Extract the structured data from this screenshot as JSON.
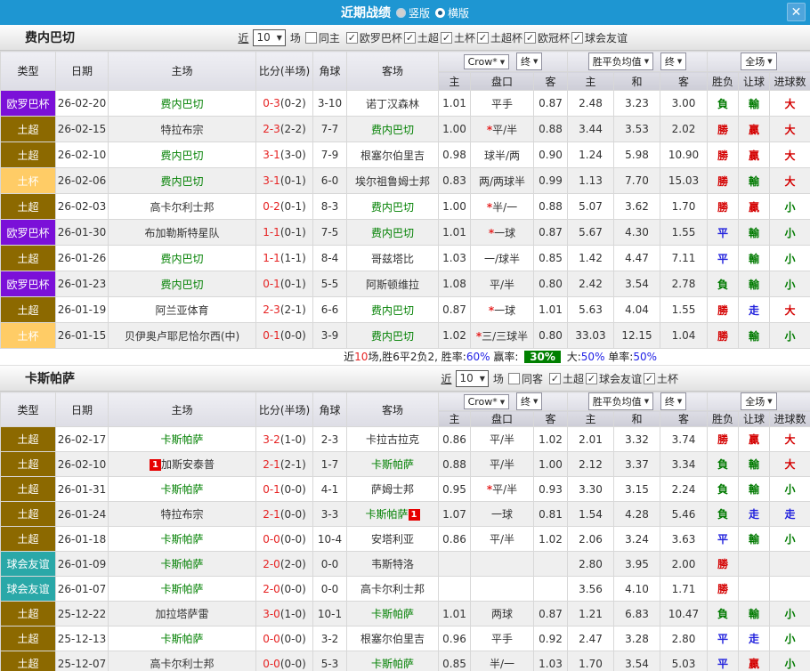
{
  "titlebar": {
    "title": "近期战绩",
    "radio_vertical": "竖版",
    "radio_horizontal": "横版",
    "selected_layout": "横版",
    "close_label": "✕"
  },
  "table_header": {
    "cols": [
      "类型",
      "日期",
      "主场",
      "比分(半场)",
      "角球",
      "客场"
    ],
    "group1": "Crow*",
    "group1b": "终",
    "group2": "胜平负均值",
    "group2b": "终",
    "group3": "全场",
    "sub": [
      "主",
      "盘口",
      "客",
      "主",
      "和",
      "客",
      "胜负",
      "让球",
      "进球数"
    ]
  },
  "colors": {
    "titlebar": "#1E96D2",
    "comp": {
      "欧罗巴杯": "#7B10D8",
      "土超": "#8C6900",
      "土杯": "#FFCC66",
      "球会友谊": "#2AA8A8"
    },
    "result": {
      "勝": "red",
      "負": "green",
      "平": "blue",
      "贏": "red",
      "輸": "green",
      "走": "blue",
      "大": "red",
      "小": "green"
    },
    "focus_team": "#008000",
    "score": "#E62222",
    "win_rate_badge": "#008000"
  },
  "sections": [
    {
      "team": "费内巴切",
      "filter": {
        "near": "近",
        "count": "10",
        "games": "场",
        "same_label": "同主",
        "same_checked": false,
        "leagues": [
          {
            "label": "欧罗巴杯",
            "checked": true
          },
          {
            "label": "土超",
            "checked": true
          },
          {
            "label": "土杯",
            "checked": true
          },
          {
            "label": "土超杯",
            "checked": true
          },
          {
            "label": "欧冠杯",
            "checked": true
          },
          {
            "label": "球会友谊",
            "checked": true
          }
        ]
      },
      "summary": [
        {
          "text": "近",
          "style": "plain"
        },
        {
          "text": "10",
          "style": "red"
        },
        {
          "text": "场,胜6平2负2, 胜率:",
          "style": "plain"
        },
        {
          "text": "60%",
          "style": "blue"
        },
        {
          "text": " 赢率: ",
          "style": "plain"
        },
        {
          "text": "30%",
          "style": "badge"
        },
        {
          "text": " 大:",
          "style": "plain"
        },
        {
          "text": "50%",
          "style": "blue"
        },
        {
          "text": " 单率:",
          "style": "plain"
        },
        {
          "text": "50%",
          "style": "blue"
        }
      ],
      "rows": [
        {
          "comp": "欧罗巴杯",
          "date": "26-02-20",
          "home": {
            "name": "费内巴切",
            "focus": true
          },
          "score": "0-3",
          "half": "(0-2)",
          "corner": "3-10",
          "away": {
            "name": "诺丁汉森林"
          },
          "odds": [
            "1.01",
            "平手",
            "0.87"
          ],
          "star": false,
          "avg": [
            "2.48",
            "3.23",
            "3.00"
          ],
          "res": [
            "負",
            "輸",
            "大"
          ]
        },
        {
          "comp": "土超",
          "date": "26-02-15",
          "home": {
            "name": "特拉布宗"
          },
          "score": "2-3",
          "half": "(2-2)",
          "corner": "7-7",
          "away": {
            "name": "费内巴切",
            "focus": true
          },
          "odds": [
            "1.00",
            "平/半",
            "0.88"
          ],
          "star": true,
          "avg": [
            "3.44",
            "3.53",
            "2.02"
          ],
          "res": [
            "勝",
            "贏",
            "大"
          ]
        },
        {
          "comp": "土超",
          "date": "26-02-10",
          "home": {
            "name": "费内巴切",
            "focus": true
          },
          "score": "3-1",
          "half": "(3-0)",
          "corner": "7-9",
          "away": {
            "name": "根塞尔伯里吉"
          },
          "odds": [
            "0.98",
            "球半/两",
            "0.90"
          ],
          "star": false,
          "avg": [
            "1.24",
            "5.98",
            "10.90"
          ],
          "res": [
            "勝",
            "贏",
            "大"
          ]
        },
        {
          "comp": "土杯",
          "date": "26-02-06",
          "home": {
            "name": "费内巴切",
            "focus": true
          },
          "score": "3-1",
          "half": "(0-1)",
          "corner": "6-0",
          "away": {
            "name": "埃尔祖鲁姆士邦"
          },
          "odds": [
            "0.83",
            "两/两球半",
            "0.99"
          ],
          "star": false,
          "avg": [
            "1.13",
            "7.70",
            "15.03"
          ],
          "res": [
            "勝",
            "輸",
            "大"
          ]
        },
        {
          "comp": "土超",
          "date": "26-02-03",
          "home": {
            "name": "高卡尔利士邦"
          },
          "score": "0-2",
          "half": "(0-1)",
          "corner": "8-3",
          "away": {
            "name": "费内巴切",
            "focus": true
          },
          "odds": [
            "1.00",
            "半/一",
            "0.88"
          ],
          "star": true,
          "avg": [
            "5.07",
            "3.62",
            "1.70"
          ],
          "res": [
            "勝",
            "贏",
            "小"
          ]
        },
        {
          "comp": "欧罗巴杯",
          "date": "26-01-30",
          "home": {
            "name": "布加勒斯特星队"
          },
          "score": "1-1",
          "half": "(0-1)",
          "corner": "7-5",
          "away": {
            "name": "费内巴切",
            "focus": true
          },
          "odds": [
            "1.01",
            "一球",
            "0.87"
          ],
          "star": true,
          "avg": [
            "5.67",
            "4.30",
            "1.55"
          ],
          "res": [
            "平",
            "輸",
            "小"
          ]
        },
        {
          "comp": "土超",
          "date": "26-01-26",
          "home": {
            "name": "费内巴切",
            "focus": true
          },
          "score": "1-1",
          "half": "(1-1)",
          "corner": "8-4",
          "away": {
            "name": "哥兹塔比"
          },
          "odds": [
            "1.03",
            "一/球半",
            "0.85"
          ],
          "star": false,
          "avg": [
            "1.42",
            "4.47",
            "7.11"
          ],
          "res": [
            "平",
            "輸",
            "小"
          ]
        },
        {
          "comp": "欧罗巴杯",
          "date": "26-01-23",
          "home": {
            "name": "费内巴切",
            "focus": true
          },
          "score": "0-1",
          "half": "(0-1)",
          "corner": "5-5",
          "away": {
            "name": "阿斯顿维拉"
          },
          "odds": [
            "1.08",
            "平/半",
            "0.80"
          ],
          "star": false,
          "avg": [
            "2.42",
            "3.54",
            "2.78"
          ],
          "res": [
            "負",
            "輸",
            "小"
          ]
        },
        {
          "comp": "土超",
          "date": "26-01-19",
          "home": {
            "name": "阿兰亚体育"
          },
          "score": "2-3",
          "half": "(2-1)",
          "corner": "6-6",
          "away": {
            "name": "费内巴切",
            "focus": true
          },
          "odds": [
            "0.87",
            "一球",
            "1.01"
          ],
          "star": true,
          "avg": [
            "5.63",
            "4.04",
            "1.55"
          ],
          "res": [
            "勝",
            "走",
            "大"
          ]
        },
        {
          "comp": "土杯",
          "date": "26-01-15",
          "home": {
            "name": "贝伊奥卢耶尼恰尔西(中)"
          },
          "score": "0-1",
          "half": "(0-0)",
          "corner": "3-9",
          "away": {
            "name": "费内巴切",
            "focus": true
          },
          "odds": [
            "1.02",
            "三/三球半",
            "0.80"
          ],
          "star": true,
          "avg": [
            "33.03",
            "12.15",
            "1.04"
          ],
          "res": [
            "勝",
            "輸",
            "小"
          ]
        }
      ]
    },
    {
      "team": "卡斯帕萨",
      "filter": {
        "near": "近",
        "count": "10",
        "games": "场",
        "same_label": "同客",
        "same_checked": false,
        "leagues": [
          {
            "label": "土超",
            "checked": true
          },
          {
            "label": "球会友谊",
            "checked": true
          },
          {
            "label": "土杯",
            "checked": true
          }
        ]
      },
      "summary": null,
      "rows": [
        {
          "comp": "土超",
          "date": "26-02-17",
          "home": {
            "name": "卡斯帕萨",
            "focus": true
          },
          "score": "3-2",
          "half": "(1-0)",
          "corner": "2-3",
          "away": {
            "name": "卡拉古拉克"
          },
          "odds": [
            "0.86",
            "平/半",
            "1.02"
          ],
          "star": false,
          "avg": [
            "2.01",
            "3.32",
            "3.74"
          ],
          "res": [
            "勝",
            "贏",
            "大"
          ]
        },
        {
          "comp": "土超",
          "date": "26-02-10",
          "home": {
            "name": "加斯安泰普",
            "card": "1",
            "cardPos": "before"
          },
          "score": "2-1",
          "half": "(2-1)",
          "corner": "1-7",
          "away": {
            "name": "卡斯帕萨",
            "focus": true
          },
          "odds": [
            "0.88",
            "平/半",
            "1.00"
          ],
          "star": false,
          "avg": [
            "2.12",
            "3.37",
            "3.34"
          ],
          "res": [
            "負",
            "輸",
            "大"
          ]
        },
        {
          "comp": "土超",
          "date": "26-01-31",
          "home": {
            "name": "卡斯帕萨",
            "focus": true
          },
          "score": "0-1",
          "half": "(0-0)",
          "corner": "4-1",
          "away": {
            "name": "萨姆士邦"
          },
          "odds": [
            "0.95",
            "平/半",
            "0.93"
          ],
          "star": true,
          "avg": [
            "3.30",
            "3.15",
            "2.24"
          ],
          "res": [
            "負",
            "輸",
            "小"
          ]
        },
        {
          "comp": "土超",
          "date": "26-01-24",
          "home": {
            "name": "特拉布宗"
          },
          "score": "2-1",
          "half": "(0-0)",
          "corner": "3-3",
          "away": {
            "name": "卡斯帕萨",
            "focus": true,
            "card": "1",
            "cardPos": "after"
          },
          "odds": [
            "1.07",
            "一球",
            "0.81"
          ],
          "star": false,
          "avg": [
            "1.54",
            "4.28",
            "5.46"
          ],
          "res": [
            "負",
            "走",
            "走"
          ]
        },
        {
          "comp": "土超",
          "date": "26-01-18",
          "home": {
            "name": "卡斯帕萨",
            "focus": true
          },
          "score": "0-0",
          "half": "(0-0)",
          "corner": "10-4",
          "away": {
            "name": "安塔利亚"
          },
          "odds": [
            "0.86",
            "平/半",
            "1.02"
          ],
          "star": false,
          "avg": [
            "2.06",
            "3.24",
            "3.63"
          ],
          "res": [
            "平",
            "輸",
            "小"
          ]
        },
        {
          "comp": "球会友谊",
          "date": "26-01-09",
          "home": {
            "name": "卡斯帕萨",
            "focus": true
          },
          "score": "2-0",
          "half": "(2-0)",
          "corner": "0-0",
          "away": {
            "name": "韦斯特洛"
          },
          "odds": [
            "",
            "",
            ""
          ],
          "star": false,
          "avg": [
            "2.80",
            "3.95",
            "2.00"
          ],
          "res": [
            "勝",
            "",
            ""
          ]
        },
        {
          "comp": "球会友谊",
          "date": "26-01-07",
          "home": {
            "name": "卡斯帕萨",
            "focus": true
          },
          "score": "2-0",
          "half": "(0-0)",
          "corner": "0-0",
          "away": {
            "name": "高卡尔利士邦"
          },
          "odds": [
            "",
            "",
            ""
          ],
          "star": false,
          "avg": [
            "3.56",
            "4.10",
            "1.71"
          ],
          "res": [
            "勝",
            "",
            ""
          ]
        },
        {
          "comp": "土超",
          "date": "25-12-22",
          "home": {
            "name": "加拉塔萨雷"
          },
          "score": "3-0",
          "half": "(1-0)",
          "corner": "10-1",
          "away": {
            "name": "卡斯帕萨",
            "focus": true
          },
          "odds": [
            "1.01",
            "两球",
            "0.87"
          ],
          "star": false,
          "avg": [
            "1.21",
            "6.83",
            "10.47"
          ],
          "res": [
            "負",
            "輸",
            "小"
          ]
        },
        {
          "comp": "土超",
          "date": "25-12-13",
          "home": {
            "name": "卡斯帕萨",
            "focus": true
          },
          "score": "0-0",
          "half": "(0-0)",
          "corner": "3-2",
          "away": {
            "name": "根塞尔伯里吉"
          },
          "odds": [
            "0.96",
            "平手",
            "0.92"
          ],
          "star": false,
          "avg": [
            "2.47",
            "3.28",
            "2.80"
          ],
          "res": [
            "平",
            "走",
            "小"
          ]
        },
        {
          "comp": "土超",
          "date": "25-12-07",
          "home": {
            "name": "高卡尔利士邦"
          },
          "score": "0-0",
          "half": "(0-0)",
          "corner": "5-3",
          "away": {
            "name": "卡斯帕萨",
            "focus": true
          },
          "odds": [
            "0.85",
            "半/一",
            "1.03"
          ],
          "star": false,
          "avg": [
            "1.70",
            "3.54",
            "5.03"
          ],
          "res": [
            "平",
            "贏",
            "小"
          ]
        }
      ]
    }
  ]
}
